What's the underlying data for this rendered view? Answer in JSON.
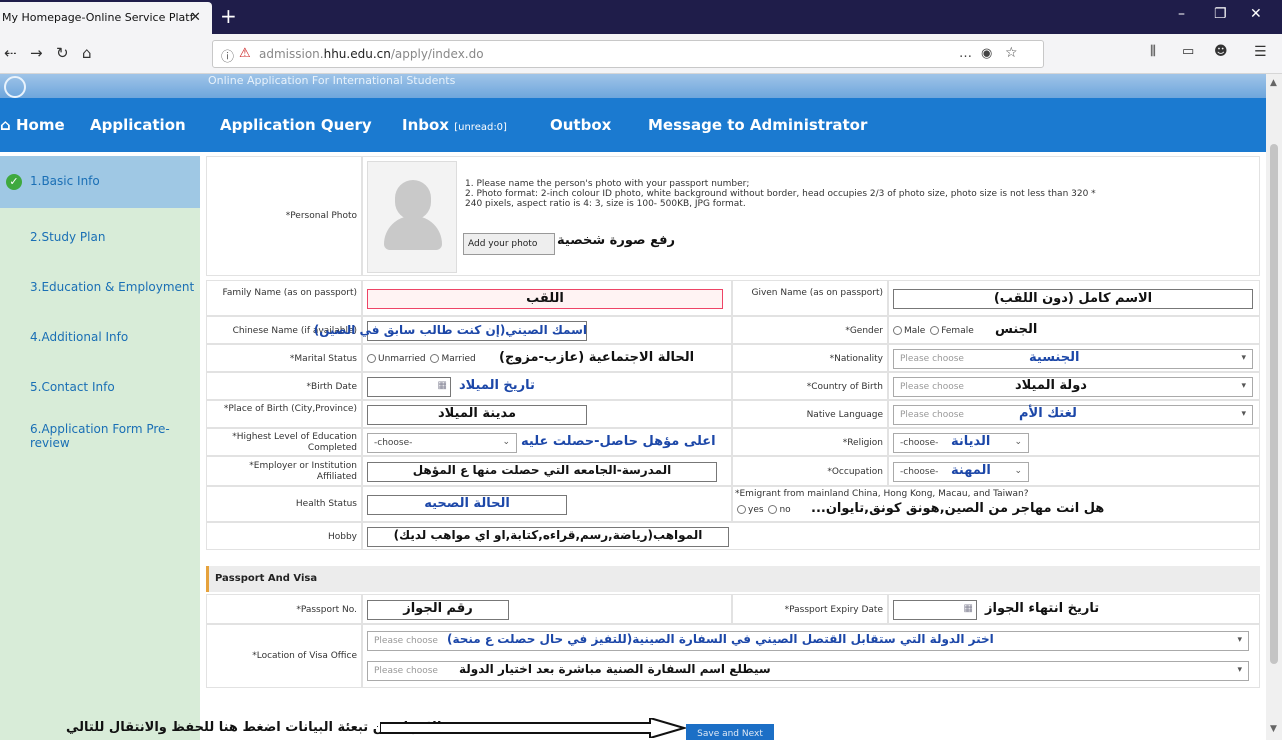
{
  "browser": {
    "tab_title": "My Homepage-Online Service Platf",
    "tab_close": "✕",
    "new_tab": "+",
    "url_prefix": "admission.",
    "url_domain": "hhu.edu.cn",
    "url_path": "/apply/index.do",
    "minimize": "–",
    "maximize": "❐",
    "close": "✕"
  },
  "banner": {
    "subtitle": "Online Application For International Students"
  },
  "menu": {
    "home": "Home",
    "application": "Application",
    "query": "Application Query",
    "inbox": "Inbox",
    "inbox_unread": "[unread:0]",
    "outbox": "Outbox",
    "message": "Message to Administrator"
  },
  "sidebar": {
    "items": [
      {
        "label": "1.Basic Info"
      },
      {
        "label": "2.Study Plan"
      },
      {
        "label": "3.Education & Employment"
      },
      {
        "label": "4.Additional Info"
      },
      {
        "label": "5.Contact Info"
      },
      {
        "label": "6.Application Form Pre-"
      },
      {
        "label": "review"
      }
    ]
  },
  "photo": {
    "label": "*Personal Photo",
    "note1": "1. Please name the person's photo with your passport number;",
    "note2": "2. Photo format: 2-inch colour ID photo, white background without border, head occupies 2/3 of photo size, photo size is not less than 320 *",
    "note3": "240 pixels, aspect ratio is 4: 3, size is 100- 500KB, JPG format.",
    "button": "Add your photo",
    "ar": "رفع صورة شخصية"
  },
  "fields": {
    "family_label": "Family Name (as on passport)",
    "family_ar": "اللقب",
    "given_label": "Given Name (as on passport)",
    "given_ar": "الاسم كامل (دون اللقب)",
    "chinese_label": "Chinese Name (if available)",
    "chinese_ar": "اسمك الصيني(إن كنت طالب سابق في الصين)",
    "gender_label": "*Gender",
    "gender_male": "Male",
    "gender_female": "Female",
    "gender_ar": "الجنس",
    "marital_label": "*Marital Status",
    "marital_unmarried": "Unmarried",
    "marital_married": "Married",
    "marital_ar": "الحالة الاجتماعية (عازب-مزوج)",
    "nationality_label": "*Nationality",
    "nationality_ph": "Please choose",
    "nationality_ar": "الجنسية",
    "birth_label": "*Birth Date",
    "birth_ar": "تاريخ الميلاد",
    "country_label": "*Country of Birth",
    "country_ph": "Please choose",
    "country_ar": "دولة الميلاد",
    "place_label": "*Place of Birth (City,Province)",
    "place_ar": "مدينة الميلاد",
    "native_label": "Native Language",
    "native_ph": "Please choose",
    "native_ar": "لغتك الأم",
    "edu_label": "*Highest Level of Education Completed",
    "edu_ph": "-choose-",
    "edu_ar": "اعلى مؤهل حاصل-حصلت عليه",
    "religion_label": "*Religion",
    "religion_ph": "-choose-",
    "religion_ar": "الديانة",
    "employer_label": "*Employer or Institution Affiliated",
    "employer_ar": "المدرسة-الجامعه التي حصلت منها ع المؤهل",
    "occupation_label": "*Occupation",
    "occupation_ph": "-choose-",
    "occupation_ar": "المهنة",
    "health_label": "Health Status",
    "health_ar": "الحالة الصحيه",
    "emigrant_label": "*Emigrant from mainland China, Hong Kong, Macau, and Taiwan?",
    "emigrant_yes": "yes",
    "emigrant_no": "no",
    "emigrant_ar": "هل انت مهاجر من الصين,هونق كونق,تايوان...",
    "hobby_label": "Hobby",
    "hobby_ar": "المواهب(رياضة,رسم,قراءه,كتابة,او اي مواهب لديك)"
  },
  "passport": {
    "section": "Passport And Visa",
    "no_label": "*Passport No.",
    "no_ar": "رقم الجواز",
    "expiry_label": "*Passport Expiry Date",
    "expiry_ar": "تاريخ انتهاء الجواز",
    "visa_label": "*Location of Visa Office",
    "visa_ph1": "Please choose",
    "visa_ar1": "اختر الدولة التي ستقابل القتصل الصيني في السفارة الصينية(للتفيز في حال حصلت ع منحة)",
    "visa_ph2": "Please choose",
    "visa_ar2": "سيطلع اسم السفارة الصنية مباشرة بعد اختيار الدولة"
  },
  "footer": {
    "note_ar": "بعد الانتهاء من تبعئة البيانات اضغط هنا للحفظ والانتقال للتالي",
    "save": "Save and Next"
  }
}
